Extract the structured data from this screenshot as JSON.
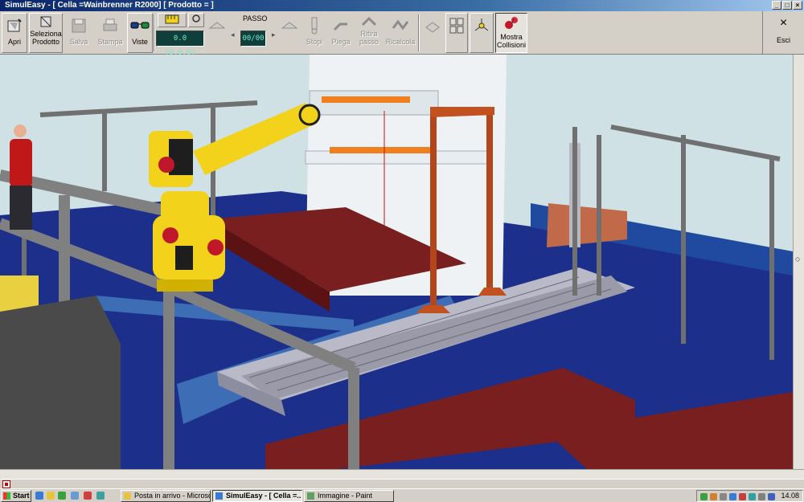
{
  "window": {
    "title": "SimulEasy - [ Cella =Wainbrenner R2000] [ Prodotto = ]",
    "controls": [
      "_",
      "□",
      "×"
    ]
  },
  "toolbar": {
    "apri": "Apri",
    "seleziona_prodotto": "Seleziona Prodotto",
    "salva": "Salva",
    "stampa": "Stampa",
    "viste": "Viste",
    "counter_display": "0.0 (0.0.0)",
    "passo_label": "PASSO",
    "passo_value": "00/00",
    "stopi": "Stopi",
    "piega": "Piega",
    "ritira_passo": "Ritira passo",
    "ricalcola": "Ricalcola",
    "mostra_collisioni": "Mostra Collisioni",
    "esci": "Esci",
    "esci_icon": "×"
  },
  "viewport": {
    "scene": "3D robot cell simulation"
  },
  "taskbar": {
    "start": "Start",
    "tasks": [
      {
        "label": "Posta in arrivo - Microsof...",
        "active": false
      },
      {
        "label": "SimulEasy - [ Cella =...",
        "active": true
      },
      {
        "label": "Immagine - Paint",
        "active": false
      }
    ],
    "clock": "14.08"
  },
  "colors": {
    "lcd_bg": "#0e3f3a",
    "robot_yellow": "#f2d21a",
    "floor_blue": "#1c2f8a",
    "rust_orange": "#b3471b"
  }
}
